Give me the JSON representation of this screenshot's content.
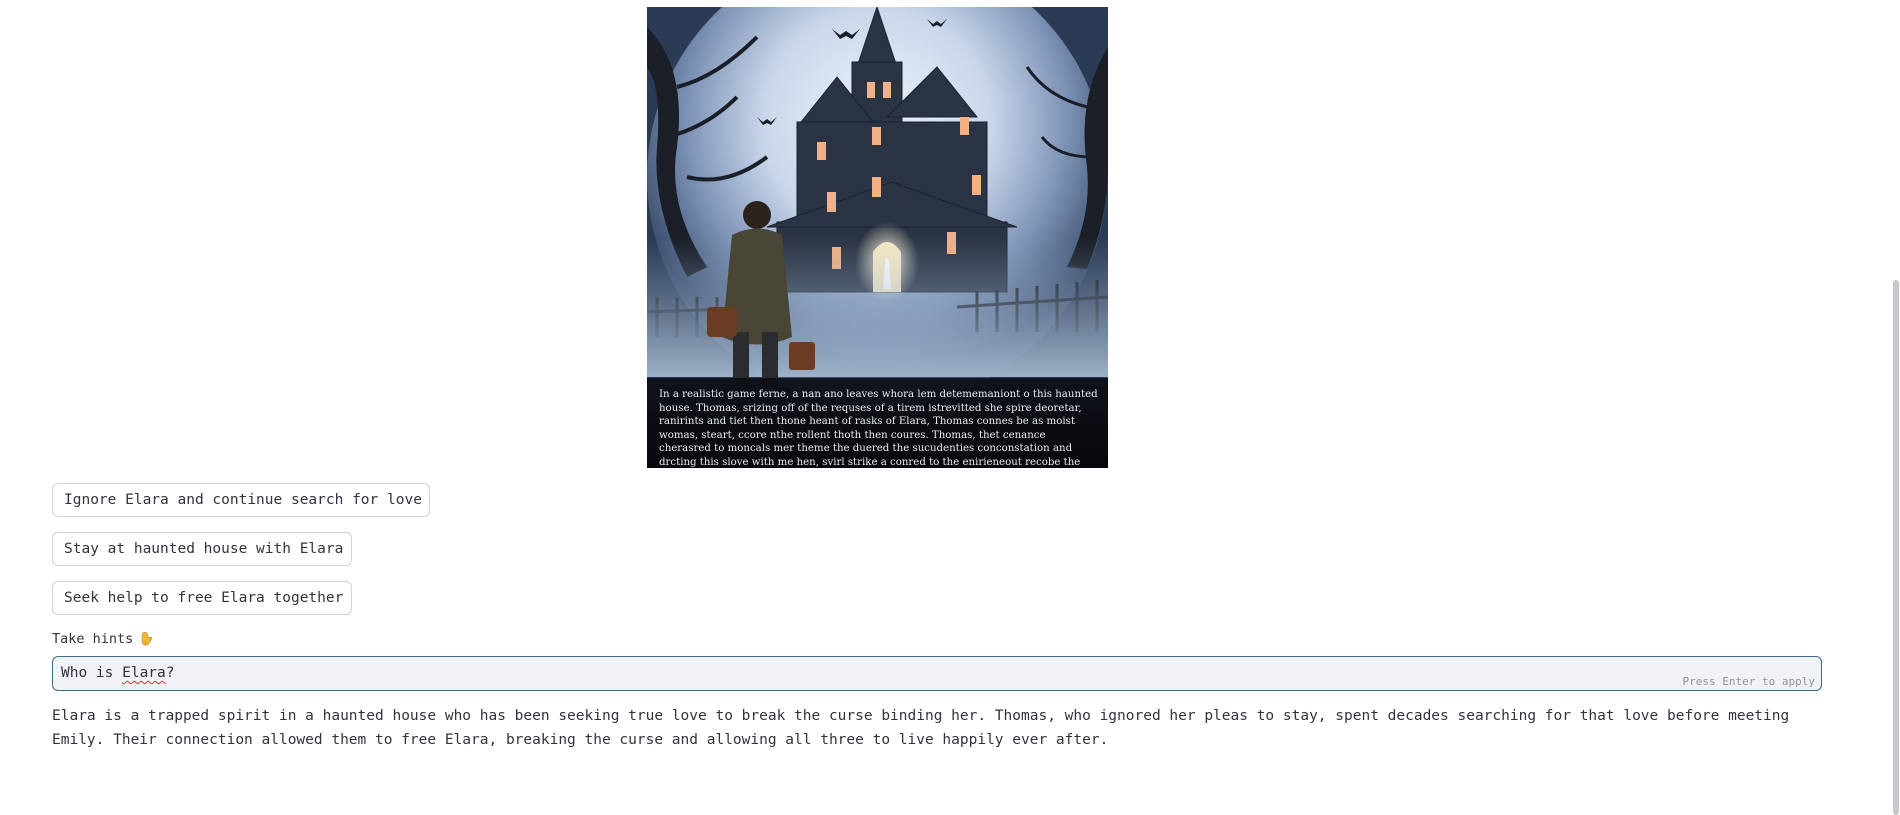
{
  "scene": {
    "caption": "In a realistic game ferne, a nan ano leaves whora lem detememaniont o this haunted house. Thomas, srizing off of the requses of a tirem istrevitted she spire deoretar, ranirints and tiet then thone heant of rasks of Elara, Thomas connes be as moist womas, steart, ccore nthe rollent thoth then coures. Thomas, thet cenance cherasred to moncals mer theme the duered the sucudenties conconstation and drcting this slove with me hen, svirl strike a conred to the enirieneout recobe the curse entapping her Bount spirit."
  },
  "choices": [
    {
      "label": "Ignore Elara and continue search for love"
    },
    {
      "label": "Stay at haunted house with Elara"
    },
    {
      "label": "Seek help to free Elara together"
    }
  ],
  "hints": {
    "label": "Take hints",
    "icon": "pointing-down-hand-icon",
    "input_value_prefix": "Who is ",
    "input_value_word": "Elara",
    "input_value_suffix": "?",
    "enter_hint": "Press Enter to apply"
  },
  "answer": {
    "text": "Elara is a trapped spirit in a haunted house who has been seeking true love to break the curse binding her. Thomas, who ignored her pleas to stay, spent decades searching for that love before meeting Emily. Their connection allowed them to free Elara, breaking the curse and allowing all three to live happily ever after."
  },
  "colors": {
    "input_border": "#3f6b82",
    "input_background": "#f0f2f6",
    "text": "#31333f"
  }
}
